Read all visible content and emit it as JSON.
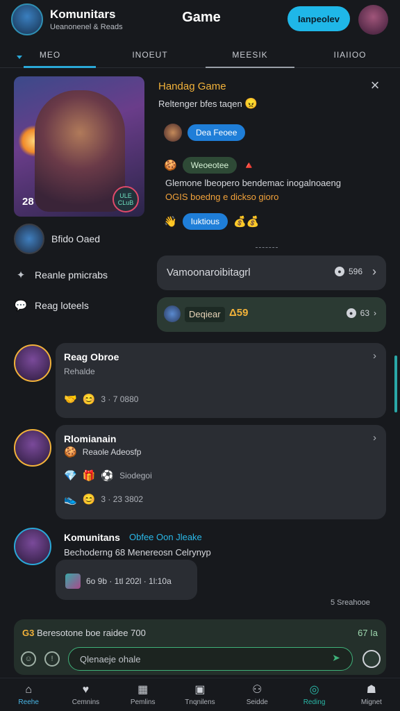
{
  "header": {
    "brand_title": "Komunitars",
    "brand_subtitle": "Ueanonenel & Reads",
    "center_title": "Game",
    "action_label": "Ianpeolev"
  },
  "tabs": [
    {
      "label": "MEO"
    },
    {
      "label": "INOEUT"
    },
    {
      "label": "MEESIK"
    },
    {
      "label": "IIAIIOO"
    }
  ],
  "game": {
    "art_number": "28",
    "art_badge": "ULE CLuB",
    "title": "Handag Game",
    "subtitle": "Reltenger bfes taqen",
    "chip1": "Dea Feoee",
    "chip2": "Weoeotee",
    "desc_line1": "Glemone lbeopero bendemac inogalnoaeng",
    "desc_line2": "OGIS boedng e dickso gioro",
    "chip3": "Iuktious"
  },
  "left_list": {
    "profile_label": "Bfido Oaed",
    "item1": "Reanle pmicrabs",
    "item2": "Reag loteels"
  },
  "panels": {
    "a_title": "Vamoonaroibitagrl",
    "a_count": "596",
    "b_label": "Deqiear",
    "b_gold": "Δ59",
    "b_count": "63"
  },
  "posts": [
    {
      "name": "Reag Obroe",
      "sub": "Rehalde",
      "meta": "3 · 7 0880"
    },
    {
      "name": "Rlomianain",
      "line1": "Reaole Adeosfp",
      "meta1": "Siodegoi",
      "meta2": "3 · 23 3802"
    }
  ],
  "post3": {
    "name": "Komunitans",
    "tag": "Obfee Oon Jleake",
    "body": "Bechoderng 68 Menereosn Celrynyp",
    "bubble_meta": "6o 9b · 1tl 202l · 1l:10a",
    "footnote": "5 Sreahooe"
  },
  "composer": {
    "info_prefix": "G3",
    "info_text": "Beresotone boe raidee 700",
    "count": "67 Ia",
    "placeholder": "Qlenaeje ohale"
  },
  "nav": [
    {
      "label": "Reehe",
      "icon": "home-icon"
    },
    {
      "label": "Cemnins",
      "icon": "heart-icon"
    },
    {
      "label": "Pemlins",
      "icon": "grid-icon"
    },
    {
      "label": "Tnqnilens",
      "icon": "image-icon"
    },
    {
      "label": "Seidde",
      "icon": "user-group-icon"
    },
    {
      "label": "Reding",
      "icon": "game-icon"
    },
    {
      "label": "Mignet",
      "icon": "profile-icon"
    }
  ],
  "colors": {
    "accent": "#2aa8d8",
    "gold": "#f2b23a",
    "green": "#3fb27a"
  }
}
